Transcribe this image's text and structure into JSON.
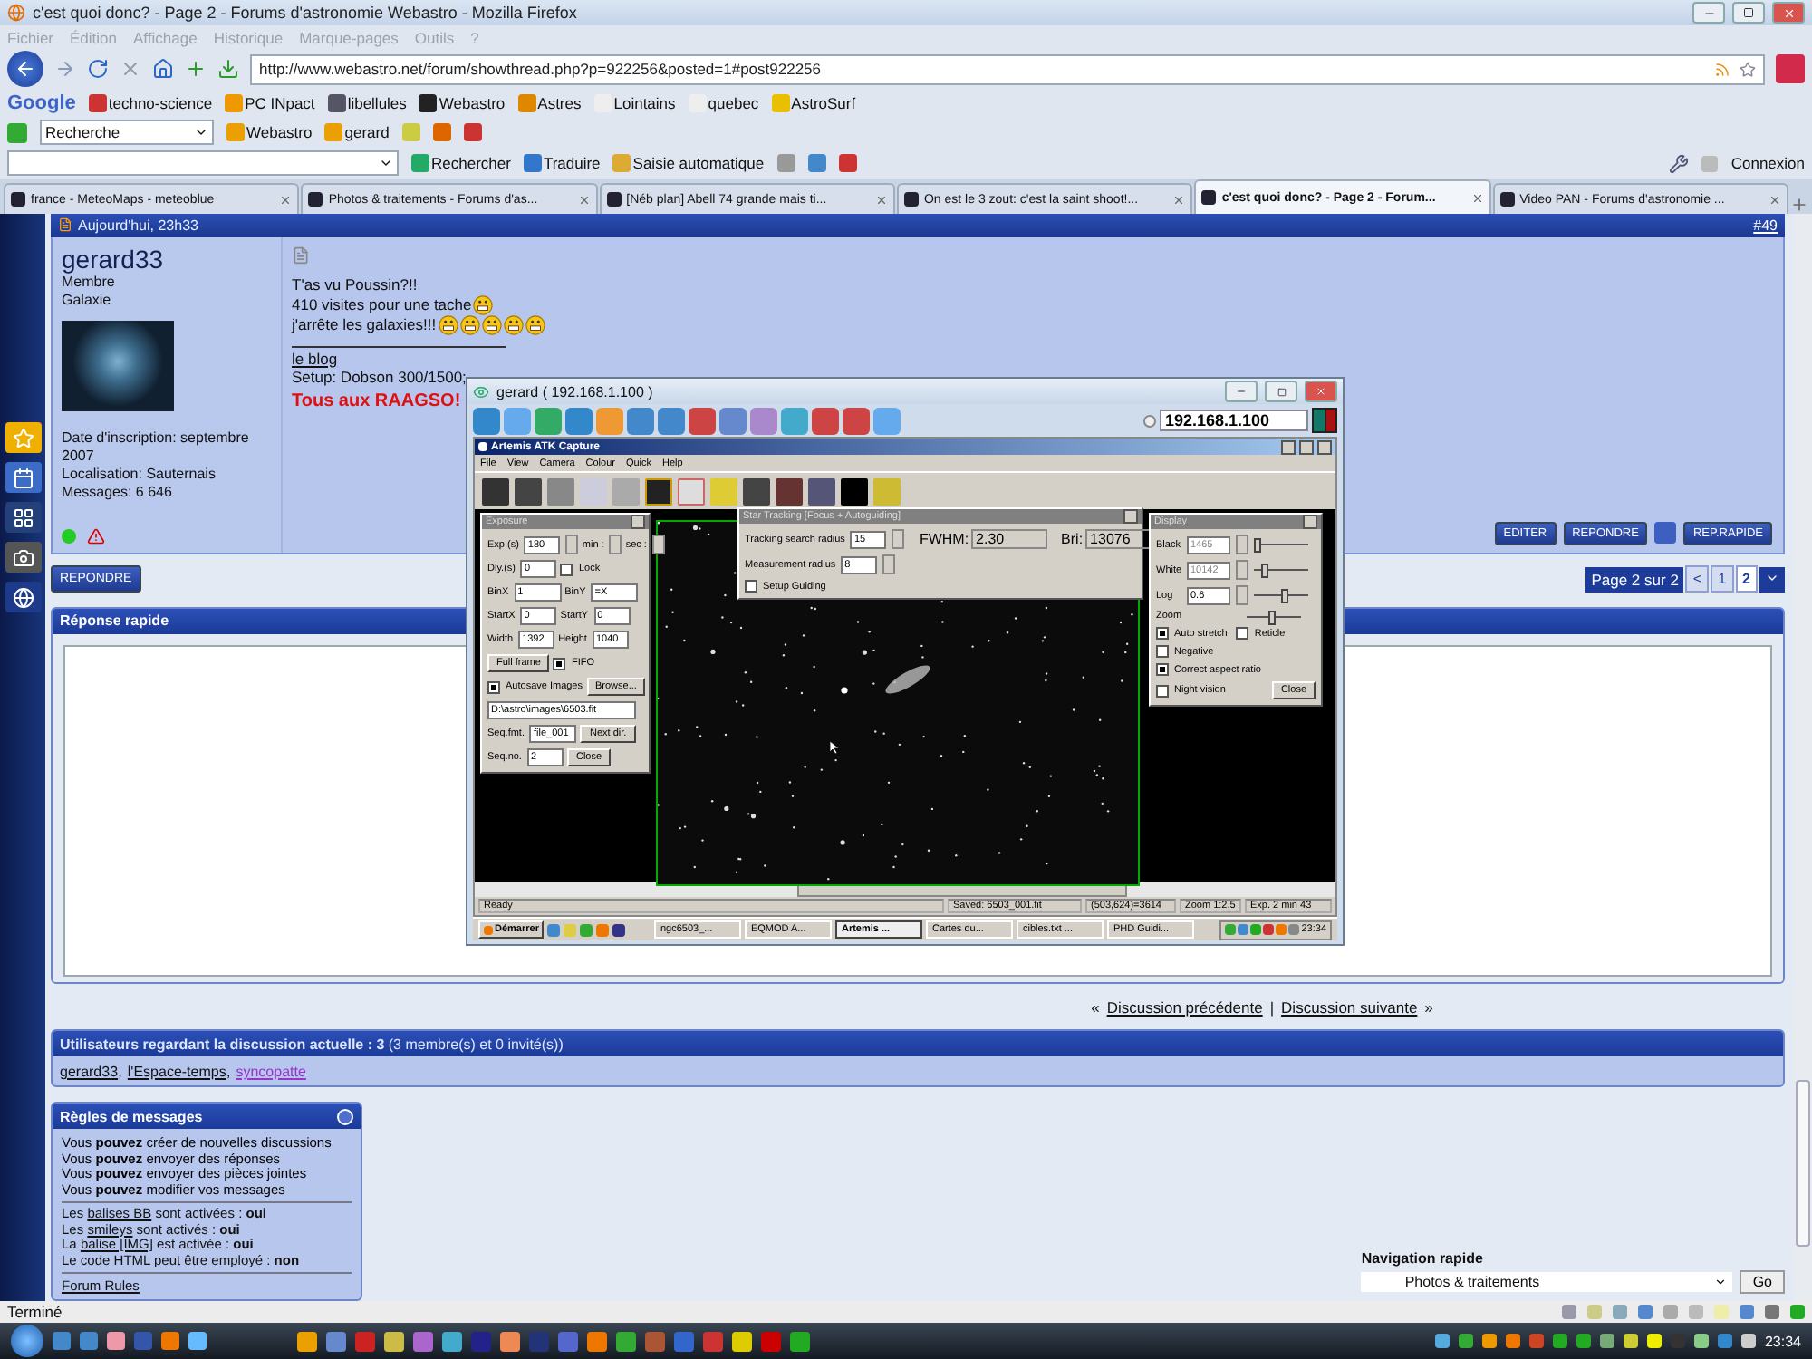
{
  "window": {
    "title": "c'est quoi donc? - Page 2 - Forums d'astronomie Webastro - Mozilla Firefox"
  },
  "menu": [
    "Fichier",
    "Édition",
    "Affichage",
    "Historique",
    "Marque-pages",
    "Outils",
    "?"
  ],
  "address": {
    "value": "http://www.webastro.net/forum/showthread.php?p=922256&posted=1#post922256"
  },
  "bookmarks": {
    "logo": "Google",
    "items": [
      "techno-science",
      "PC INpact",
      "libellules",
      "Webastro",
      "Astres",
      "Lointains",
      "quebec",
      "AstroSurf"
    ]
  },
  "toolbar1": {
    "search_value": "Recherche",
    "items": [
      "Webastro",
      "gerard"
    ]
  },
  "toolbar2": {
    "items": [
      "Rechercher",
      "Traduire",
      "Saisie automatique"
    ],
    "account": "Connexion"
  },
  "tabs": [
    {
      "label": "france - MeteoMaps - meteoblue",
      "selected": false
    },
    {
      "label": "Photos & traitements - Forums d'as...",
      "selected": false
    },
    {
      "label": "[Néb plan] Abell 74 grande mais ti...",
      "selected": false
    },
    {
      "label": "On est le 3 zout: c'est la saint shoot!...",
      "selected": false
    },
    {
      "label": "c'est quoi donc? - Page 2 - Forum...",
      "selected": true
    },
    {
      "label": "Video PAN - Forums d'astronomie ...",
      "selected": false
    }
  ],
  "post": {
    "date": "Aujourd'hui, 23h33",
    "number": "#49",
    "user": "gerard33",
    "rank": "Membre",
    "user_title": "Galaxie",
    "details": [
      "Date d'inscription: septembre 2007",
      "Localisation: Sauternais",
      "Messages: 6 646"
    ],
    "lines": [
      "T'as vu Poussin?!!",
      "410 visites pour une tache",
      "j'arrête les galaxies!!!"
    ],
    "signature_link": "le blog",
    "setup": "Setup: Dobson 300/1500;",
    "slogan": "Tous aux RAAGSO!",
    "buttons": [
      "EDITER",
      "REPONDRE",
      "REP.RAPIDE"
    ]
  },
  "reply_button": "REPONDRE",
  "pagination": {
    "label": "Page 2 sur 2",
    "prev": "<",
    "pages": [
      {
        "label": "1",
        "selected": false
      },
      {
        "label": "2",
        "selected": true
      }
    ]
  },
  "quick_reply": {
    "title": "Réponse rapide"
  },
  "thread_nav": {
    "prefix": "«",
    "prev": "Discussion précédente",
    "separator": "|",
    "next": "Discussion suivante",
    "suffix": "»"
  },
  "viewers": {
    "separator": ",",
    "title": "**Utilisateurs regardant la discussion actuelle : 3** (3 membre(s) et 0 invité(s))",
    "users": [
      {
        "name": "gerard33",
        "visited": false
      },
      {
        "name": "l'Espace-temps",
        "visited": false
      },
      {
        "name": "syncopatte",
        "visited": true
      }
    ]
  },
  "rules": {
    "title": "Règles de messages",
    "permissions": [
      "Vous **pouvez** créer de nouvelles discussions",
      "Vous **pouvez** envoyer des réponses",
      "Vous **pouvez** envoyer des pièces jointes",
      "Vous **pouvez** modifier vos messages"
    ],
    "settings": [
      {
        "before": "Les ",
        "link": "balises BB",
        "after": " sont activées : ",
        "value": "oui"
      },
      {
        "before": "Les ",
        "link": "smileys",
        "after": " sont activés : ",
        "value": "oui"
      },
      {
        "before": "La ",
        "link": "balise [IMG]",
        "after": " est activée : ",
        "value": "oui"
      },
      {
        "before": "Le code HTML peut être employé : ",
        "value": "non"
      }
    ],
    "footer_link": "Forum Rules"
  },
  "quick_nav": {
    "label": "Navigation rapide",
    "value": "Photos & traitements",
    "button": "Go"
  },
  "status_bar": "Terminé",
  "clock": "23:34",
  "remote": {
    "title": "gerard ( 192.168.1.100 )",
    "address": "192.168.1.100",
    "app": {
      "title": "Artemis ATK Capture",
      "menu": [
        "File",
        "View",
        "Camera",
        "Colour",
        "Quick",
        "Help"
      ],
      "exposure": {
        "title": "Exposure",
        "rows": [
          [
            {
              "kind": "field",
              "label": "Exp.(s)",
              "value": "180",
              "spin": true
            },
            {
              "kind": "spin",
              "label": "min :"
            },
            {
              "kind": "spin",
              "label": "sec :"
            }
          ],
          [
            {
              "kind": "field",
              "label": "Dly.(s)",
              "value": "0",
              "spin": false
            },
            {
              "kind": "check",
              "label": "Lock",
              "checked": false
            }
          ],
          [
            {
              "kind": "select",
              "label": "BinX",
              "value": "1"
            },
            {
              "kind": "select",
              "label": "BinY",
              "value": "=X"
            }
          ],
          [
            {
              "kind": "field",
              "label": "StartX",
              "value": "0",
              "spin": false
            },
            {
              "kind": "field",
              "label": "StartY",
              "value": "0",
              "spin": false
            }
          ],
          [
            {
              "kind": "field",
              "label": "Width",
              "value": "1392",
              "spin": false
            },
            {
              "kind": "field",
              "label": "Height",
              "value": "1040",
              "spin": false
            }
          ],
          [
            {
              "kind": "button",
              "label": "Full frame"
            },
            {
              "kind": "check",
              "label": "FIFO",
              "checked": true
            }
          ],
          [
            {
              "kind": "check",
              "label": "Autosave Images",
              "checked": true
            },
            {
              "kind": "button",
              "label": "Browse..."
            }
          ],
          [
            {
              "kind": "path",
              "value": "D:\\astro\\images\\6503.fit"
            }
          ],
          [
            {
              "kind": "select",
              "label": "Seq.fmt.",
              "value": "file_001"
            },
            {
              "kind": "button",
              "label": "Next dir."
            }
          ],
          [
            {
              "kind": "field",
              "label": "Seq.no.",
              "value": "2",
              "spin": false
            },
            {
              "kind": "button",
              "label": "Close"
            }
          ]
        ]
      },
      "tracking": {
        "title": "Star Tracking [Focus + Autoguiding]",
        "rows": [
          [
            {
              "kind": "field",
              "label": "Tracking search radius",
              "value": "15",
              "spin": true
            }
          ],
          [
            {
              "kind": "field",
              "label": "Measurement radius",
              "value": "8",
              "spin": true
            }
          ],
          [
            {
              "kind": "check",
              "label": "Setup Guiding",
              "checked": false
            }
          ]
        ],
        "readouts": [
          {
            "label": "FWHM:",
            "value": "2.30"
          },
          {
            "label": "Bri:",
            "value": "13076"
          }
        ]
      },
      "display": {
        "title": "Display",
        "sliders": [
          {
            "label": "Black",
            "value": "1465",
            "disabled": true,
            "level": 0.05
          },
          {
            "label": "White",
            "value": "10142",
            "disabled": true,
            "level": 0.2
          },
          {
            "label": "Log",
            "value": "0.6",
            "disabled": false,
            "level": 0.55
          },
          {
            "label": "Zoom",
            "level": 0.45
          }
        ],
        "checks": [
          [
            {
              "label": "Auto stretch",
              "checked": true
            },
            {
              "label": "Reticle",
              "checked": false
            }
          ],
          [
            {
              "label": "Negative",
              "checked": false
            }
          ],
          [
            {
              "label": "Correct aspect ratio",
              "checked": true
            }
          ],
          [
            {
              "label": "Night vision",
              "checked": false
            }
          ]
        ],
        "button": "Close"
      },
      "status": [
        "Ready",
        "Saved: 6503_001.fit",
        "(503,624)=3614",
        "Zoom 1:2.5",
        "Exp. 2 min 43"
      ]
    },
    "taskbar": {
      "start": "Démarrer",
      "tasks": [
        {
          "label": "ngc6503_...",
          "selected": false
        },
        {
          "label": "EQMOD A...",
          "selected": false
        },
        {
          "label": "Artemis ...",
          "selected": true
        },
        {
          "label": "Cartes du...",
          "selected": false
        },
        {
          "label": "cibles.txt ...",
          "selected": false
        },
        {
          "label": "PHD Guidi...",
          "selected": false
        }
      ],
      "clock": "23:34"
    }
  }
}
